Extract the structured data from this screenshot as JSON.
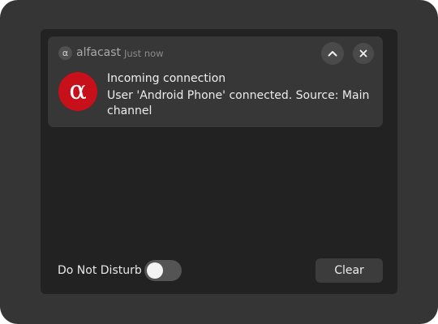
{
  "notification": {
    "app_icon_glyph": "α",
    "app_name": "alfacast",
    "time": "Just now",
    "icon_glyph": "α",
    "icon_color": "#c7101a",
    "title": "Incoming connection",
    "body": "User 'Android Phone' connected. Source: Main channel",
    "collapse_icon": "chevron-up-icon",
    "close_icon": "close-icon"
  },
  "footer": {
    "dnd_label": "Do Not Disturb",
    "dnd_enabled": false,
    "clear_label": "Clear"
  }
}
